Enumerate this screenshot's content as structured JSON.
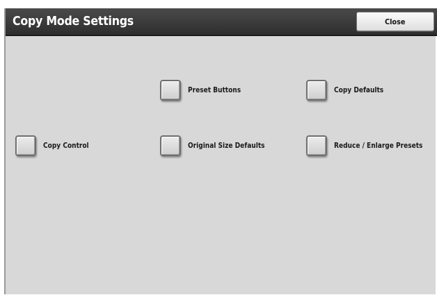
{
  "header": {
    "title": "Copy Mode Settings",
    "close_label": "Close"
  },
  "options": {
    "preset_buttons": "Preset Buttons",
    "copy_defaults": "Copy Defaults",
    "copy_control": "Copy Control",
    "original_size_defaults": "Original Size Defaults",
    "reduce_enlarge_presets": "Reduce / Enlarge Presets"
  },
  "colors": {
    "header_bg": "#3a3a3a",
    "panel_bg": "#d8d8d8",
    "title_text": "#ffffff"
  }
}
